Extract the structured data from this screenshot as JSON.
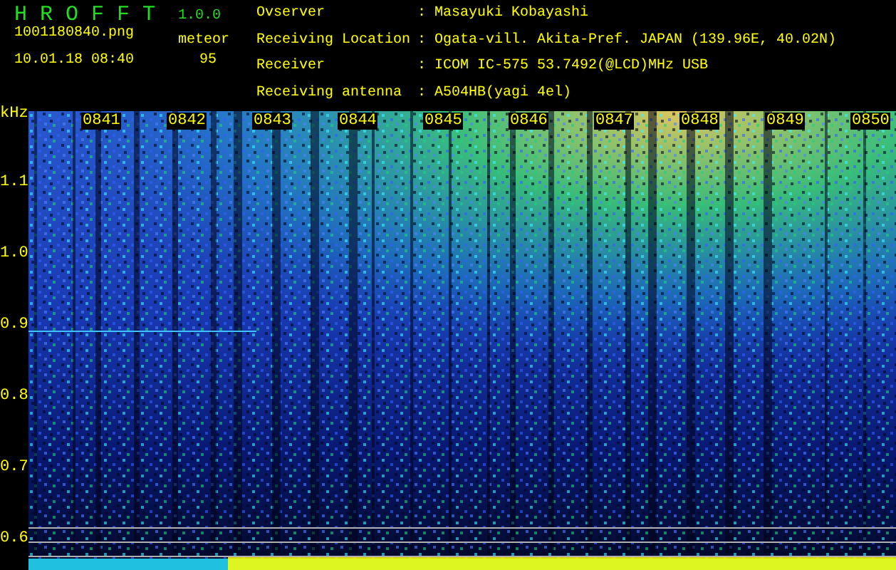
{
  "app": {
    "title": "H R O F F T",
    "version": "1.0.0",
    "filename": "1001180840.png",
    "datetime": "10.01.18 08:40",
    "mode": "meteor",
    "count": "95"
  },
  "info": [
    {
      "label": "Ovserver",
      "separator": ":",
      "value": "Masayuki Kobayashi"
    },
    {
      "label": "Receiving Location",
      "separator": ":",
      "value": "Ogata-vill. Akita-Pref. JAPAN (139.96E, 40.02N)"
    },
    {
      "label": "Receiver",
      "separator": ":",
      "value": "ICOM IC-575 53.7492(@LCD)MHz USB"
    },
    {
      "label": "Receiving antenna",
      "separator": ":",
      "value": "A504HB(yagi 4el)"
    }
  ],
  "spectrogram": {
    "unit": "kHz",
    "y_labels": [
      "1.1",
      "1.0",
      "0.9",
      "0.8",
      "0.7",
      "0.6"
    ],
    "time_labels": [
      "0841",
      "0842",
      "0843",
      "0844",
      "0845",
      "0846",
      "0847",
      "0848",
      "0849",
      "0850"
    ]
  }
}
